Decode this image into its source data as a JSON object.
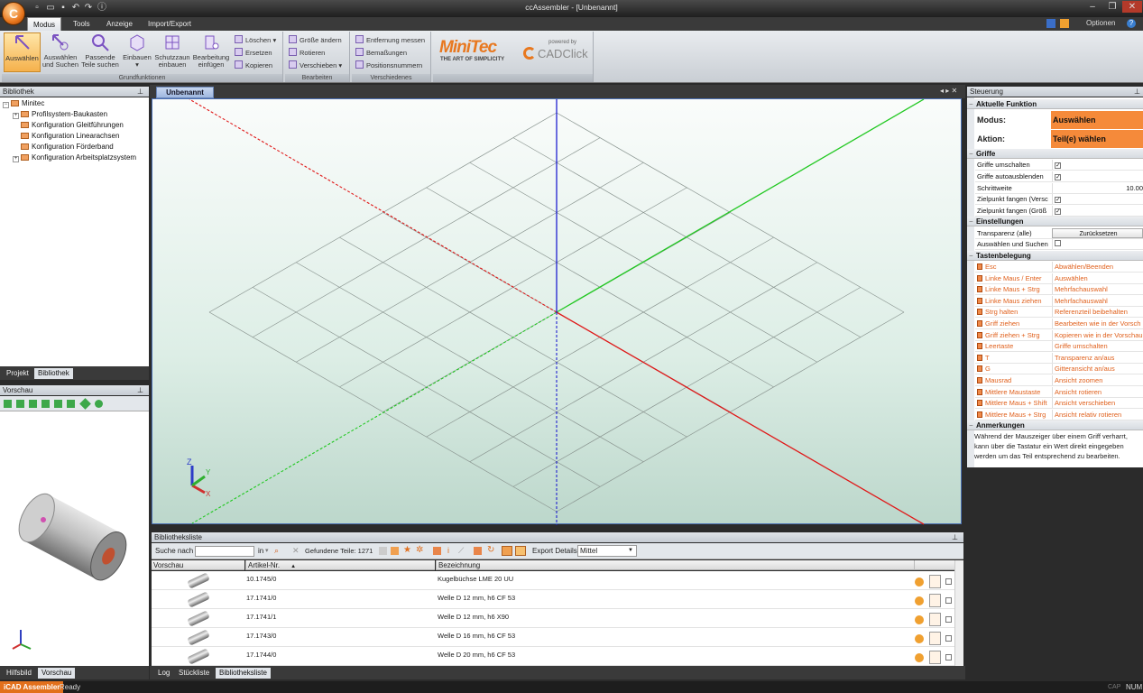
{
  "window": {
    "title": "ccAssembler - [Unbenannt]",
    "options_label": "Optionen"
  },
  "ribbon_tabs": [
    "Modus",
    "Tools",
    "Anzeige",
    "Import/Export"
  ],
  "ribbon": {
    "grundfunktionen": {
      "label": "Grundfunktionen",
      "buttons": [
        {
          "l1": "Auswählen",
          "l2": ""
        },
        {
          "l1": "Auswählen",
          "l2": "und Suchen"
        },
        {
          "l1": "Passende",
          "l2": "Teile suchen"
        },
        {
          "l1": "Einbauen",
          "l2": "▾"
        },
        {
          "l1": "Schutzzaun",
          "l2": "einbauen"
        },
        {
          "l1": "Bearbeitung",
          "l2": "einfügen"
        }
      ],
      "small": [
        "Löschen",
        "Ersetzen",
        "Kopieren"
      ]
    },
    "bearbeiten": {
      "label": "Bearbeiten",
      "small": [
        "Größe ändern",
        "Rotieren",
        "Verschieben"
      ]
    },
    "verschiedenes": {
      "label": "Verschiedenes",
      "small": [
        "Entfernung messen",
        "Bemaßungen",
        "Positionsnummern"
      ]
    },
    "logo": {
      "brand": "MiniTec",
      "tagline": "THE ART OF SIMPLICITY",
      "powered": "powered by",
      "cad": "CADClick"
    }
  },
  "library": {
    "title": "Bibliothek",
    "root": "Minitec",
    "items": [
      "Profilsystem-Baukasten",
      "Konfiguration Gleitführungen",
      "Konfiguration Linearachsen",
      "Konfiguration Förderband",
      "Konfiguration Arbeitsplatzsystem"
    ],
    "tabs": [
      "Projekt",
      "Bibliothek"
    ]
  },
  "preview": {
    "title": "Vorschau",
    "tabs": [
      "Hilfsbild",
      "Vorschau"
    ]
  },
  "document": {
    "tab": "Unbenannt"
  },
  "list": {
    "title": "Bibliotheksliste",
    "search_label": "Suche nach",
    "in_label": "in",
    "found": "Gefundene Teile: 1271",
    "export_label": "Export Details",
    "export_value": "Mittel",
    "columns": [
      "Vorschau",
      "Artikel-Nr.",
      "Bezeichnung"
    ],
    "rows": [
      {
        "art": "10.1745/0",
        "bez": "Kugelbüchse LME 20 UU"
      },
      {
        "art": "17.1741/0",
        "bez": "Welle D 12 mm, h6 CF 53"
      },
      {
        "art": "17.1741/1",
        "bez": "Welle D 12 mm, h6 X90"
      },
      {
        "art": "17.1743/0",
        "bez": "Welle D 16 mm, h6 CF 53"
      },
      {
        "art": "17.1744/0",
        "bez": "Welle D 20 mm, h6 CF 53"
      }
    ],
    "bottom_tabs": [
      "Log",
      "Stückliste",
      "Bibliotheksliste"
    ]
  },
  "steuerung": {
    "title": "Steuerung",
    "aktuelle": {
      "header": "Aktuelle Funktion",
      "modus_label": "Modus:",
      "modus_value": "Auswählen",
      "aktion_label": "Aktion:",
      "aktion_value": "Teil(e) wählen"
    },
    "griffe": {
      "header": "Griffe",
      "items": [
        "Griffe umschalten",
        "Griffe autoausblenden",
        "Schrittweite",
        "Zielpunkt fangen (Versc",
        "Zielpunkt fangen (Größ"
      ],
      "schrittweite_value": "10.00"
    },
    "einstellungen": {
      "header": "Einstellungen",
      "transparenz": "Transparenz (alle)",
      "reset": "Zurücksetzen",
      "auswaehlen": "Auswählen und Suchen"
    },
    "tasten": {
      "header": "Tastenbelegung",
      "rows": [
        {
          "k": "Esc",
          "v": "Abwählen/Beenden"
        },
        {
          "k": "Linke Maus / Enter",
          "v": "Auswählen"
        },
        {
          "k": "Linke Maus + Strg",
          "v": "Mehrfachauswahl"
        },
        {
          "k": "Linke Maus ziehen",
          "v": "Mehrfachauswahl"
        },
        {
          "k": "Strg halten",
          "v": "Referenzteil beibehalten"
        },
        {
          "k": "Griff ziehen",
          "v": "Bearbeiten wie in der Vorsch"
        },
        {
          "k": "Griff ziehen + Strg",
          "v": "Kopieren wie in der Vorschau"
        },
        {
          "k": "Leertaste",
          "v": "Griffe umschalten"
        },
        {
          "k": "T",
          "v": "Transparenz an/aus"
        },
        {
          "k": "G",
          "v": "Gitteransicht an/aus"
        },
        {
          "k": "Mausrad",
          "v": "Ansicht zoomen"
        },
        {
          "k": "Mittlere Maustaste",
          "v": "Ansicht rotieren"
        },
        {
          "k": "Mittlere Maus + Shift",
          "v": "Ansicht verschieben"
        },
        {
          "k": "Mittlere Maus + Strg",
          "v": "Ansicht relativ rotieren"
        }
      ]
    },
    "anmerkungen": {
      "header": "Anmerkungen",
      "text": "Während der Mauszeiger über einem Griff verharrt, kann über die Tastatur ein Wert direkt eingegeben werden um das Teil entsprechend zu bearbeiten."
    }
  },
  "status": {
    "app": "iCAD Assembler",
    "ready": "Ready",
    "num": "NUM",
    "cap": "CAP"
  },
  "colors": {
    "accent": "#f08a3c",
    "modus_bg": "#f58a3a",
    "key_text": "#e0601c"
  }
}
